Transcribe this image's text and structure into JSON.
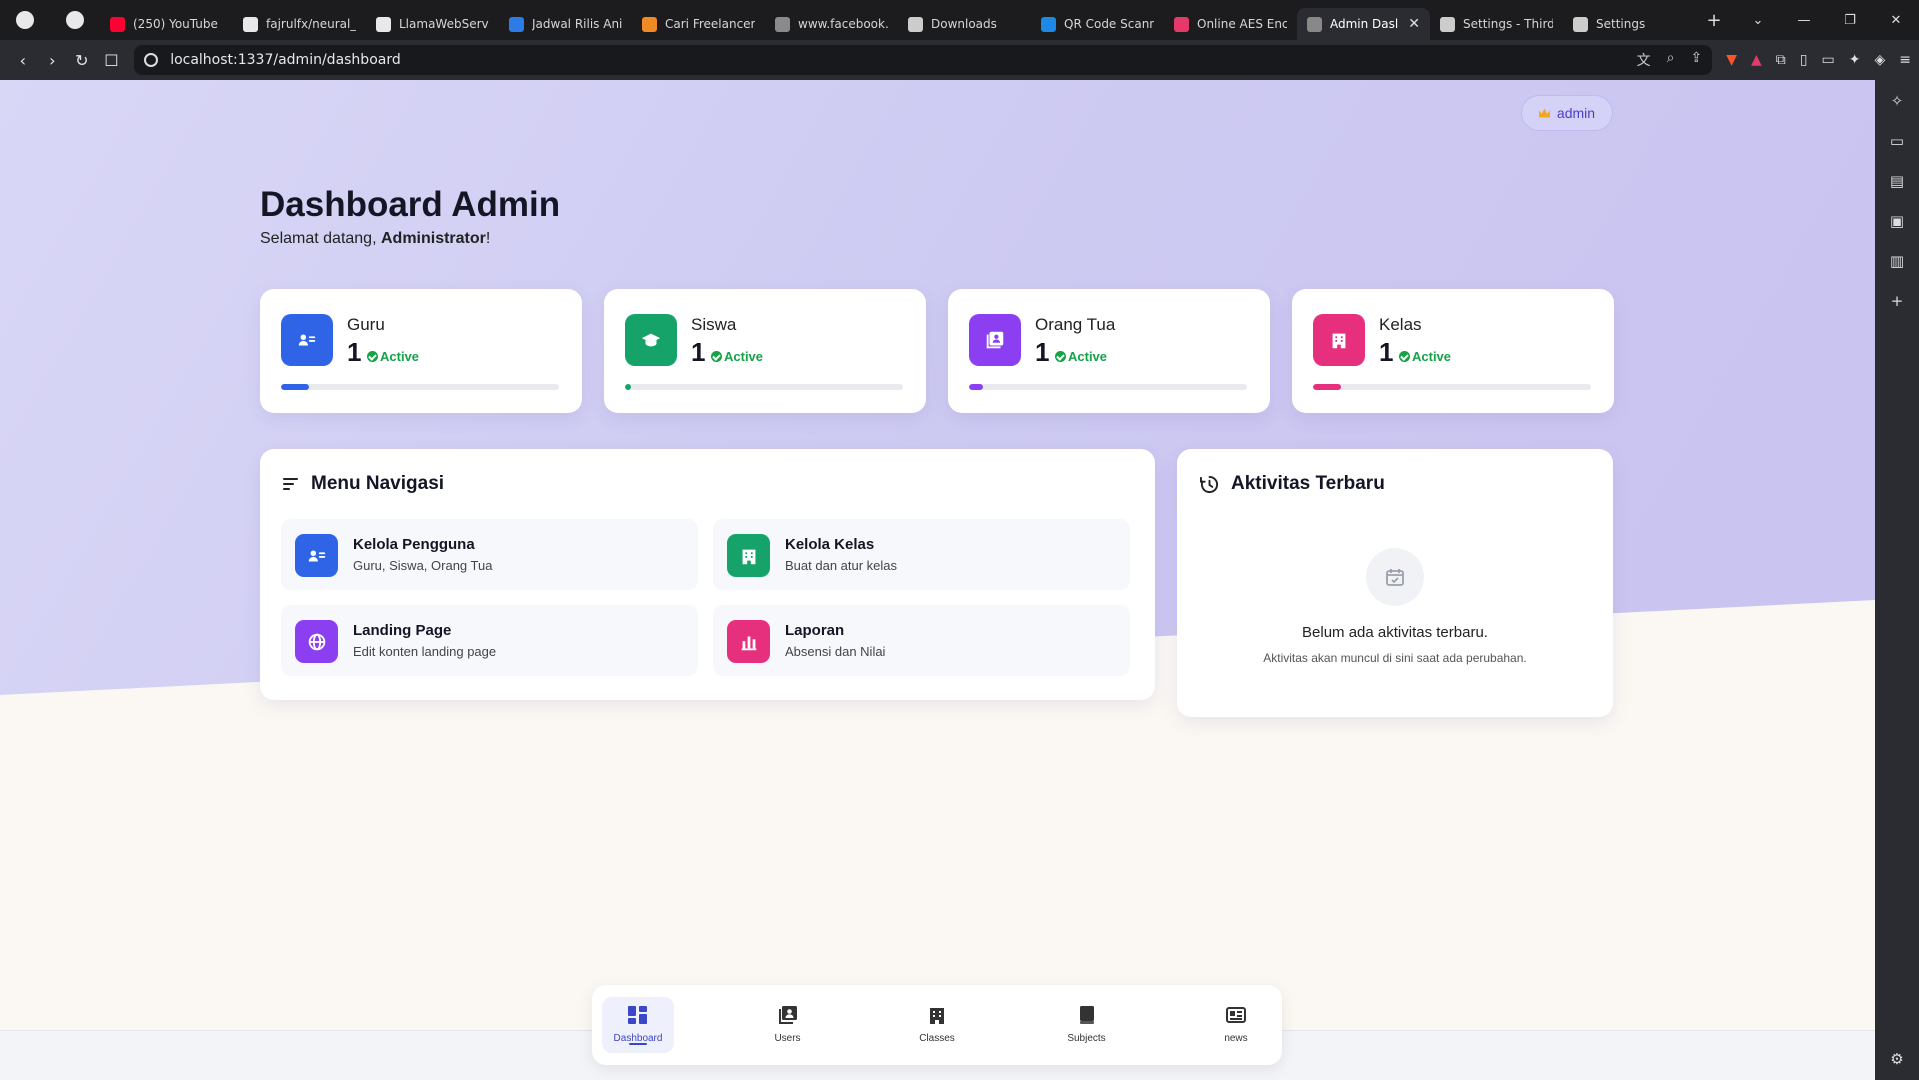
{
  "browser": {
    "tabs": [
      {
        "title": "(250) YouTube",
        "color": "#ff0033"
      },
      {
        "title": "fajrulfx/neural_n",
        "color": "#e8e8ea"
      },
      {
        "title": "LlamaWebServe",
        "color": "#e8e8ea"
      },
      {
        "title": "Jadwal Rilis Anin",
        "color": "#2d7be5"
      },
      {
        "title": "Cari Freelancer I",
        "color": "#f08a24"
      },
      {
        "title": "www.facebook.c",
        "color": "#8a8a8a"
      },
      {
        "title": "Downloads",
        "color": "#cccccc"
      },
      {
        "title": "QR Code Scann",
        "color": "#1e88e5"
      },
      {
        "title": "Online AES Encr",
        "color": "#e5386b"
      },
      {
        "title": "Admin Dasl",
        "color": "#888888"
      },
      {
        "title": "Settings - Third",
        "color": "#cccccc"
      },
      {
        "title": "Settings",
        "color": "#cccccc"
      }
    ],
    "url": "localhost:1337/admin/dashboard"
  },
  "user_chip": {
    "label": "admin"
  },
  "header": {
    "title": "Dashboard Admin",
    "welcome_prefix": "Selamat datang,",
    "welcome_name": "Administrator",
    "welcome_suffix": "!"
  },
  "stats": [
    {
      "label": "Guru",
      "count": "1",
      "status": "Active",
      "icon": "users-card-icon",
      "color": "#2f64e6",
      "progress": 0.1
    },
    {
      "label": "Siswa",
      "count": "1",
      "status": "Active",
      "icon": "graduation-cap-icon",
      "color": "#16a36a",
      "progress": 0.02
    },
    {
      "label": "Orang Tua",
      "count": "1",
      "status": "Active",
      "icon": "family-icon",
      "color": "#8b3ff0",
      "progress": 0.05
    },
    {
      "label": "Kelas",
      "count": "1",
      "status": "Active",
      "icon": "building-icon",
      "color": "#e6307e",
      "progress": 0.1
    }
  ],
  "menu": {
    "title": "Menu Navigasi",
    "items": [
      {
        "title": "Kelola Pengguna",
        "subtitle": "Guru, Siswa, Orang Tua",
        "icon": "users-card-icon",
        "color": "#2f64e6"
      },
      {
        "title": "Kelola Kelas",
        "subtitle": "Buat dan atur kelas",
        "icon": "building-icon",
        "color": "#16a36a"
      },
      {
        "title": "Landing Page",
        "subtitle": "Edit konten landing page",
        "icon": "globe-icon",
        "color": "#8b3ff0"
      },
      {
        "title": "Laporan",
        "subtitle": "Absensi dan Nilai",
        "icon": "bar-chart-icon",
        "color": "#e6307e"
      }
    ]
  },
  "activity": {
    "title": "Aktivitas Terbaru",
    "empty": "Belum ada aktivitas terbaru.",
    "empty_sub": "Aktivitas akan muncul di sini saat ada perubahan."
  },
  "bottom_nav": {
    "items": [
      {
        "label": "Dashboard",
        "icon": "dashboard-icon",
        "active": true
      },
      {
        "label": "Users",
        "icon": "users-icon",
        "active": false
      },
      {
        "label": "Classes",
        "icon": "classes-icon",
        "active": false
      },
      {
        "label": "Subjects",
        "icon": "book-icon",
        "active": false
      },
      {
        "label": "news",
        "icon": "news-icon",
        "active": false
      }
    ]
  },
  "colors": {
    "accent": "#3b46c9",
    "success": "#16a34a"
  }
}
